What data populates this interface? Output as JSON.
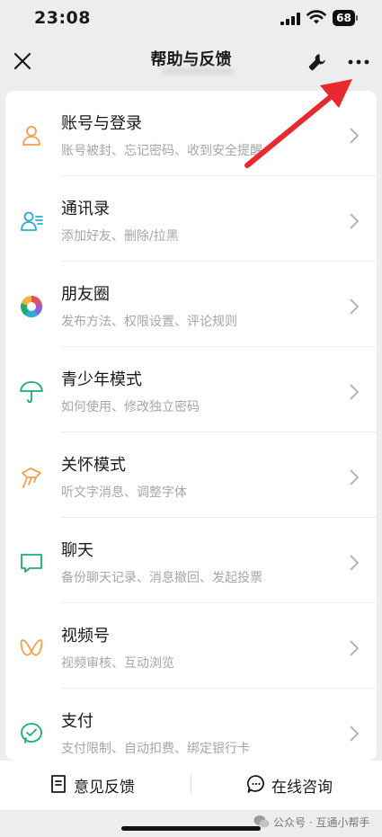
{
  "status_bar": {
    "time": "23:08",
    "battery": "68"
  },
  "header": {
    "title": "帮助与反馈"
  },
  "items": [
    {
      "title": "账号与登录",
      "subtitle": "账号被封、忘记密码、收到安全提醒",
      "icon": "person-icon",
      "color": "#f0a14a"
    },
    {
      "title": "通讯录",
      "subtitle": "添加好友、删除/拉黑",
      "icon": "contacts-icon",
      "color": "#2aaed4"
    },
    {
      "title": "朋友圈",
      "subtitle": "发布方法、权限设置、评论规则",
      "icon": "moments-icon",
      "color": "#e94c64"
    },
    {
      "title": "青少年模式",
      "subtitle": "如何使用、修改独立密码",
      "icon": "umbrella-icon",
      "color": "#18b06d"
    },
    {
      "title": "关怀模式",
      "subtitle": "听文字消息、调整字体",
      "icon": "care-icon",
      "color": "#f0a14a"
    },
    {
      "title": "聊天",
      "subtitle": "备份聊天记录、消息撤回、发起投票",
      "icon": "chat-icon",
      "color": "#18b06d"
    },
    {
      "title": "视频号",
      "subtitle": "视频审核、互动浏览",
      "icon": "channels-icon",
      "color": "#f0a14a"
    },
    {
      "title": "支付",
      "subtitle": "支付限制、自动扣费、绑定银行卡",
      "icon": "pay-icon",
      "color": "#18b06d"
    }
  ],
  "bottom_bar": {
    "feedback_label": "意见反馈",
    "consult_label": "在线咨询"
  },
  "watermark": {
    "text": "公众号 · 互通小帮手"
  },
  "colors": {
    "annotation_arrow": "#e8292f",
    "background": "#ededed"
  }
}
